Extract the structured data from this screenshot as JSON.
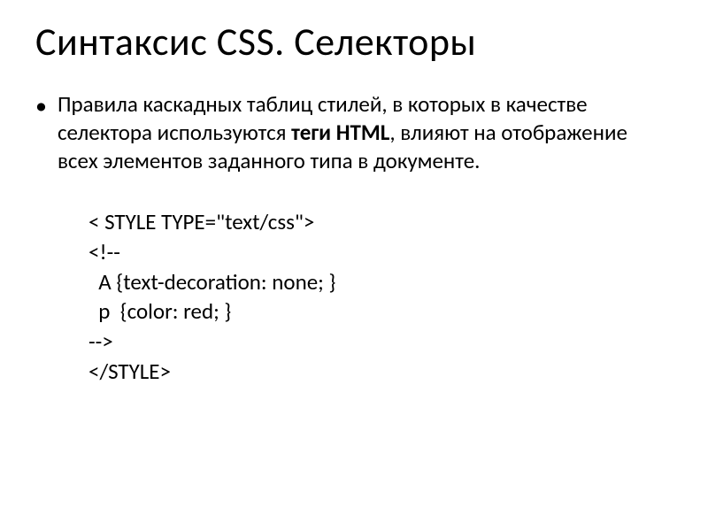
{
  "title": "Синтаксис CSS. Селекторы",
  "bullet_glyph": "•",
  "paragraph": {
    "part1": "Правила каскадных таблиц стилей, в которых в качестве селектора используются ",
    "bold": "теги HTML",
    "part2": ", влияют на отображение всех элементов заданного типа в документе."
  },
  "code": {
    "line1": "< STYLE TYPE=\"text/css\">",
    "line2": "<!--",
    "line3": "  A {text-decoration: none; }",
    "line4": "  p  {color: red; }",
    "line5": "-->",
    "line6": "</STYLE>"
  }
}
